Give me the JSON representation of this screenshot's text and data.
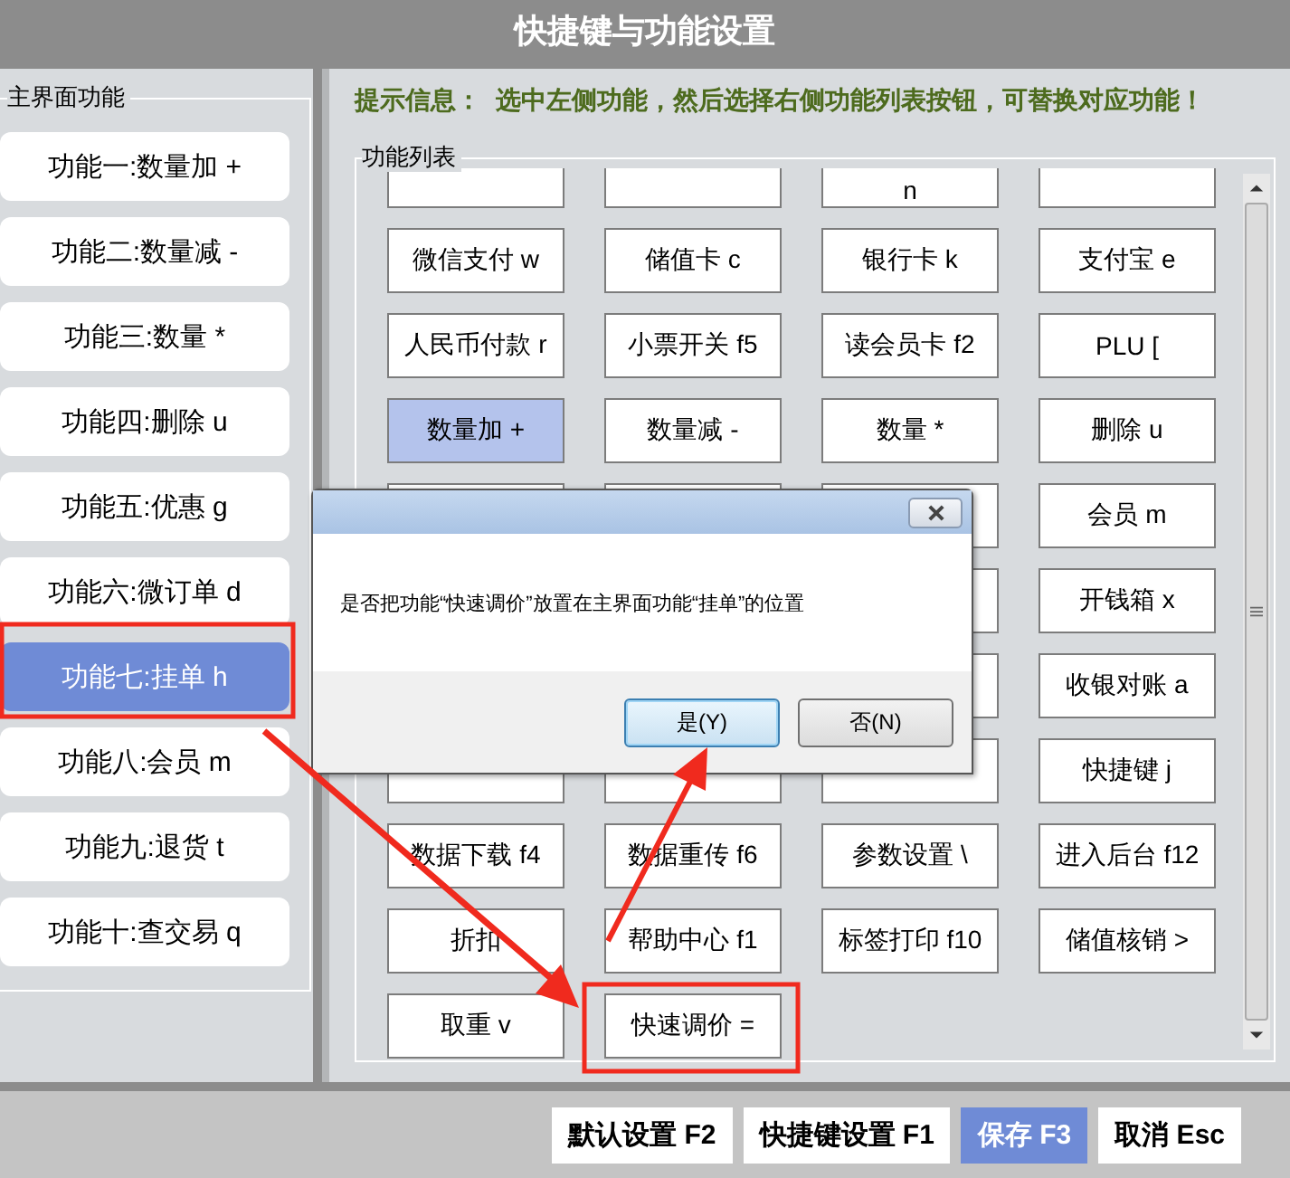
{
  "window": {
    "title": "快捷键与功能设置"
  },
  "main_functions": {
    "title": "主界面功能",
    "items": [
      {
        "label": "功能一:数量加 +",
        "selected": false
      },
      {
        "label": "功能二:数量减 -",
        "selected": false
      },
      {
        "label": "功能三:数量 *",
        "selected": false
      },
      {
        "label": "功能四:删除 u",
        "selected": false
      },
      {
        "label": "功能五:优惠 g",
        "selected": false
      },
      {
        "label": "功能六:微订单 d",
        "selected": false
      },
      {
        "label": "功能七:挂单 h",
        "selected": true
      },
      {
        "label": "功能八:会员 m",
        "selected": false
      },
      {
        "label": "功能九:退货 t",
        "selected": false
      },
      {
        "label": "功能十:查交易 q",
        "selected": false
      }
    ]
  },
  "hint": {
    "label": "提示信息：",
    "text": "选中左侧功能，然后选择右侧功能列表按钮，可替换对应功能！"
  },
  "function_list": {
    "title": "功能列表",
    "keys": [
      {
        "kind": "covered"
      },
      {
        "kind": "covered"
      },
      {
        "kind": "key",
        "label": "n",
        "selected": false
      },
      {
        "kind": "covered"
      },
      {
        "kind": "key",
        "label": "微信支付 w",
        "selected": false
      },
      {
        "kind": "key",
        "label": "储值卡 c",
        "selected": false
      },
      {
        "kind": "key",
        "label": "银行卡 k",
        "selected": false
      },
      {
        "kind": "key",
        "label": "支付宝 e",
        "selected": false
      },
      {
        "kind": "key",
        "label": "人民币付款 r",
        "selected": false
      },
      {
        "kind": "key",
        "label": "小票开关 f5",
        "selected": false
      },
      {
        "kind": "key",
        "label": "读会员卡 f2",
        "selected": false
      },
      {
        "kind": "key",
        "label": "PLU [",
        "selected": false
      },
      {
        "kind": "key",
        "label": "数量加 +",
        "selected": true
      },
      {
        "kind": "key",
        "label": "数量减 -",
        "selected": false
      },
      {
        "kind": "key",
        "label": "数量 *",
        "selected": false
      },
      {
        "kind": "key",
        "label": "删除 u",
        "selected": false
      },
      {
        "kind": "covered"
      },
      {
        "kind": "covered"
      },
      {
        "kind": "covered"
      },
      {
        "kind": "key",
        "label": "会员 m",
        "selected": false
      },
      {
        "kind": "hidden"
      },
      {
        "kind": "hidden"
      },
      {
        "kind": "covered"
      },
      {
        "kind": "key",
        "label": "开钱箱 x",
        "selected": false
      },
      {
        "kind": "hidden"
      },
      {
        "kind": "hidden"
      },
      {
        "kind": "covered"
      },
      {
        "kind": "key",
        "label": "收银对账 a",
        "selected": false
      },
      {
        "kind": "covered"
      },
      {
        "kind": "covered"
      },
      {
        "kind": "covered"
      },
      {
        "kind": "key",
        "label": "快捷键 j",
        "selected": false
      },
      {
        "kind": "key",
        "label": "数据下载 f4",
        "selected": false
      },
      {
        "kind": "key",
        "label": "数据重传 f6",
        "selected": false
      },
      {
        "kind": "key",
        "label": "参数设置 \\",
        "selected": false
      },
      {
        "kind": "key",
        "label": "进入后台 f12",
        "selected": false
      },
      {
        "kind": "key",
        "label": "折扣",
        "selected": false
      },
      {
        "kind": "key",
        "label": "帮助中心 f1",
        "selected": false
      },
      {
        "kind": "key",
        "label": "标签打印 f10",
        "selected": false
      },
      {
        "kind": "key",
        "label": "储值核销 >",
        "selected": false
      },
      {
        "kind": "key",
        "label": "取重 v",
        "selected": false
      },
      {
        "kind": "key",
        "label": "快速调价 =",
        "selected": false
      }
    ]
  },
  "dialog": {
    "message": "是否把功能“快速调价”放置在主界面功能“挂单”的位置",
    "buttons": [
      {
        "label": "是(Y)",
        "selected": true
      },
      {
        "label": "否(N)",
        "selected": false
      }
    ]
  },
  "footer_buttons": [
    {
      "label": "默认设置 F2",
      "selected": false
    },
    {
      "label": "快捷键设置 F1",
      "selected": false
    },
    {
      "label": "保存 F3",
      "selected": true
    },
    {
      "label": "取消 Esc",
      "selected": false
    }
  ]
}
